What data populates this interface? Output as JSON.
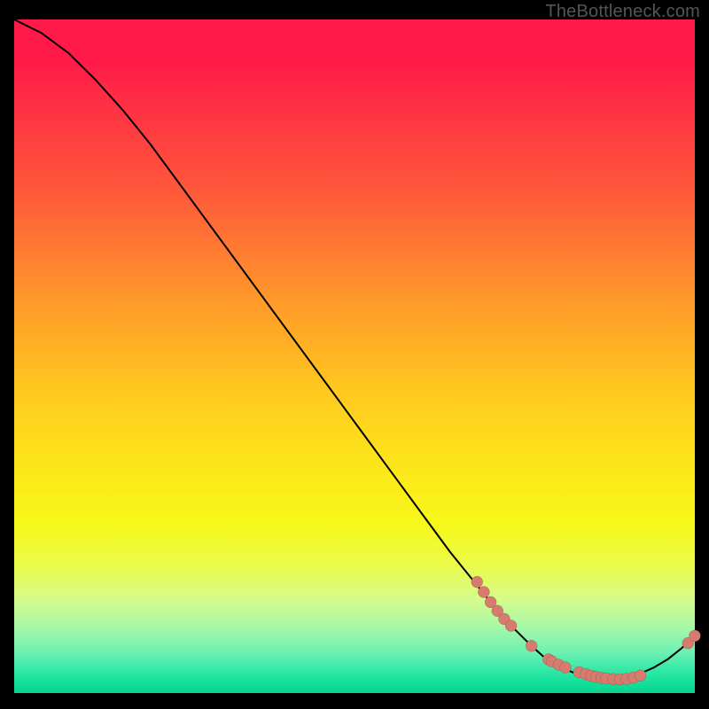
{
  "watermark": "TheBottleneck.com",
  "colors": {
    "background": "#000000",
    "curve_stroke": "#000000",
    "point_fill": "#d77b6f",
    "gradient_top": "#ff1a49",
    "gradient_bottom": "#0bd38e"
  },
  "chart_data": {
    "type": "line",
    "title": "",
    "xlabel": "",
    "ylabel": "",
    "xlim": [
      0,
      100
    ],
    "ylim": [
      0,
      100
    ],
    "grid": false,
    "series": [
      {
        "name": "bottleneck-curve",
        "x": [
          0,
          4,
          8,
          12,
          16,
          20,
          24,
          28,
          32,
          36,
          40,
          44,
          48,
          52,
          56,
          60,
          64,
          68,
          72,
          74,
          76,
          78,
          80,
          82,
          84,
          86,
          88,
          90,
          92,
          94,
          96,
          98,
          100
        ],
        "y": [
          100,
          98,
          95,
          91,
          86.5,
          81.5,
          76,
          70.5,
          65,
          59.5,
          54,
          48.5,
          43,
          37.5,
          32,
          26.5,
          21,
          16,
          11,
          9,
          7,
          5.2,
          4,
          3.1,
          2.5,
          2.1,
          2,
          2.3,
          2.9,
          3.8,
          5,
          6.6,
          8.5
        ]
      }
    ],
    "points": [
      {
        "x": 68,
        "y": 16.5
      },
      {
        "x": 69,
        "y": 15
      },
      {
        "x": 70,
        "y": 13.5
      },
      {
        "x": 71,
        "y": 12.2
      },
      {
        "x": 72,
        "y": 11
      },
      {
        "x": 73,
        "y": 10
      },
      {
        "x": 76,
        "y": 7
      },
      {
        "x": 78.5,
        "y": 5
      },
      {
        "x": 79,
        "y": 4.7
      },
      {
        "x": 80,
        "y": 4.2
      },
      {
        "x": 81,
        "y": 3.8
      },
      {
        "x": 83,
        "y": 3.1
      },
      {
        "x": 84,
        "y": 2.8
      },
      {
        "x": 84.8,
        "y": 2.55
      },
      {
        "x": 85.5,
        "y": 2.4
      },
      {
        "x": 86.3,
        "y": 2.25
      },
      {
        "x": 87,
        "y": 2.15
      },
      {
        "x": 88,
        "y": 2.07
      },
      {
        "x": 89,
        "y": 2.04
      },
      {
        "x": 90,
        "y": 2.1
      },
      {
        "x": 91,
        "y": 2.3
      },
      {
        "x": 92,
        "y": 2.6
      },
      {
        "x": 99,
        "y": 7.4
      },
      {
        "x": 100,
        "y": 8.5
      }
    ]
  }
}
